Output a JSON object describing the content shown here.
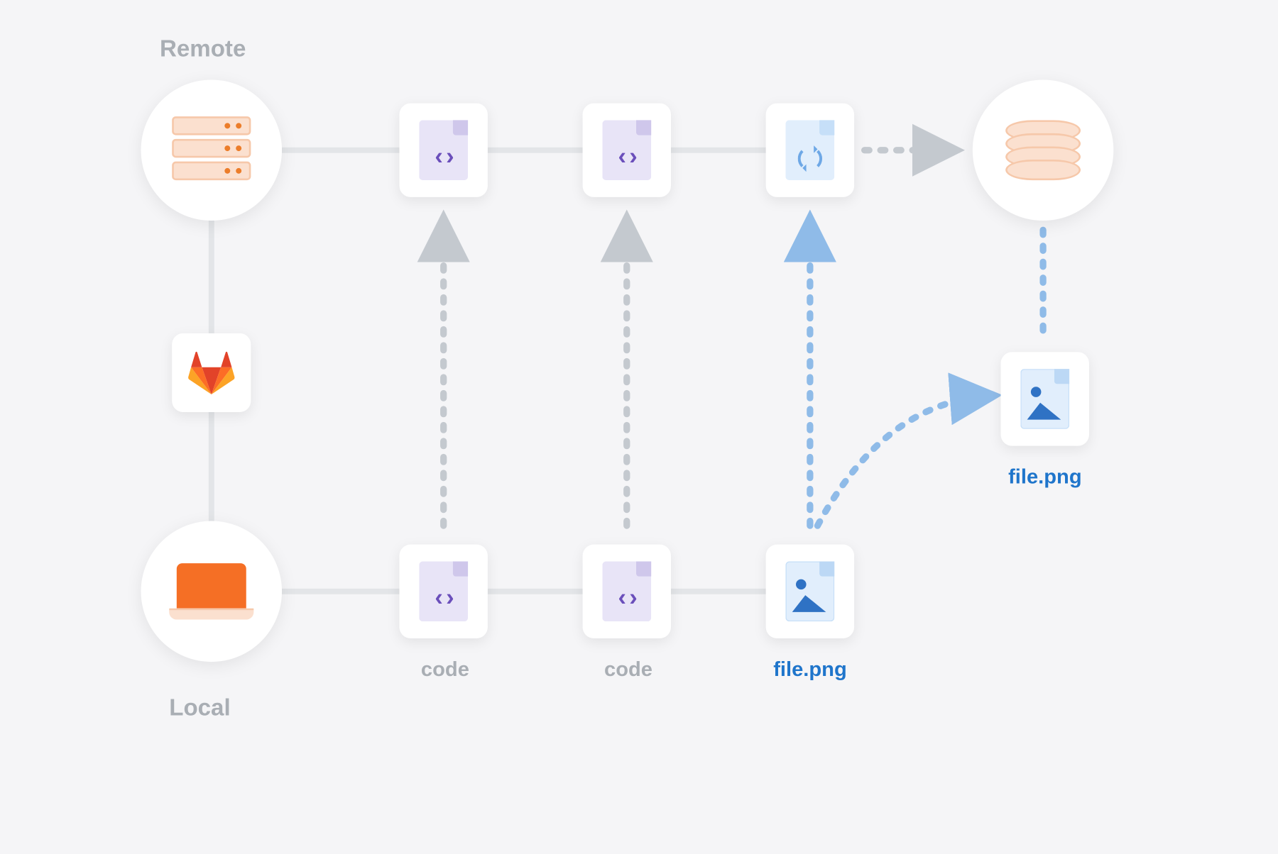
{
  "sections": {
    "remote": "Remote",
    "local": "Local"
  },
  "captions": {
    "code1": "code",
    "code2": "code",
    "file_local": "file.png",
    "file_remote": "file.png"
  },
  "icons": {
    "code_glyph": "‹ ›"
  },
  "colors": {
    "grey_arrow": "#c4c9cf",
    "blue_arrow": "#8fbbe8"
  },
  "diagram": {
    "remote_row": [
      "server",
      "code-file",
      "code-file",
      "sync-file",
      "database"
    ],
    "local_row": [
      "laptop",
      "code-file",
      "code-file",
      "image-file"
    ],
    "mid_node": "gitlab-logo",
    "lfs_target": "image-file",
    "flows": [
      {
        "from": "local.code1",
        "to": "remote.code1",
        "style": "grey-dashed"
      },
      {
        "from": "local.code2",
        "to": "remote.code2",
        "style": "grey-dashed"
      },
      {
        "from": "local.file",
        "to": "remote.sync",
        "style": "blue-dashed"
      },
      {
        "from": "local.file",
        "to": "lfs.file",
        "style": "blue-dashed-curve"
      },
      {
        "from": "remote.sync",
        "to": "remote.db",
        "style": "grey-dashed"
      },
      {
        "from": "remote.db",
        "to": "lfs.file",
        "style": "blue-dashed-down"
      }
    ]
  }
}
